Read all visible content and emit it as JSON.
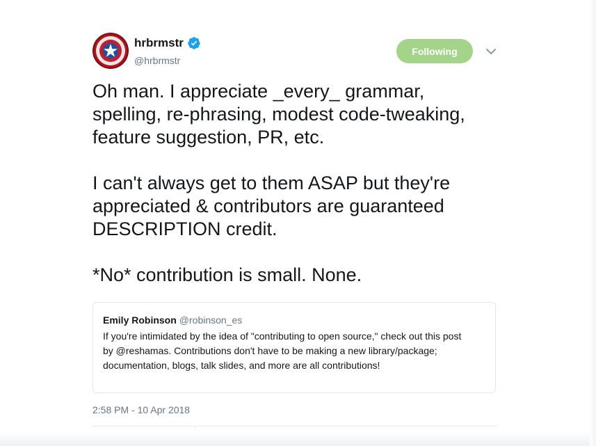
{
  "author": {
    "display_name": "hrbrmstr",
    "handle": "@hrbrmstr",
    "avatar_icon": "captain-america-shield-icon",
    "verified": true,
    "verified_icon": "verified-badge-icon"
  },
  "follow_button": {
    "label": "Following",
    "color": "#a3d489"
  },
  "menu_icon": "chevron-down-icon",
  "tweet": {
    "text": "Oh man. I appreciate _every_ grammar,\nspelling, re-phrasing, modest code-tweaking,\nfeature suggestion, PR, etc.\n\nI can't always get to them ASAP but they're\nappreciated & contributors are guaranteed\nDESCRIPTION credit.\n\n*No* contribution is small. None.",
    "timestamp": "2:58 PM - 10 Apr 2018"
  },
  "quoted_tweet": {
    "display_name": "Emily Robinson",
    "handle": "@robinson_es",
    "text": "If you're intimidated by the idea of \"contributing to open source,\" check out this post\nby @reshamas. Contributions don't have to be making a new library/package;\ndocumentation, blogs, talk slides, and more are all contributions!"
  },
  "colors": {
    "text": "#14171a",
    "secondary": "#657786",
    "verified": "#1da1f2",
    "border": "#e1e8ed"
  }
}
